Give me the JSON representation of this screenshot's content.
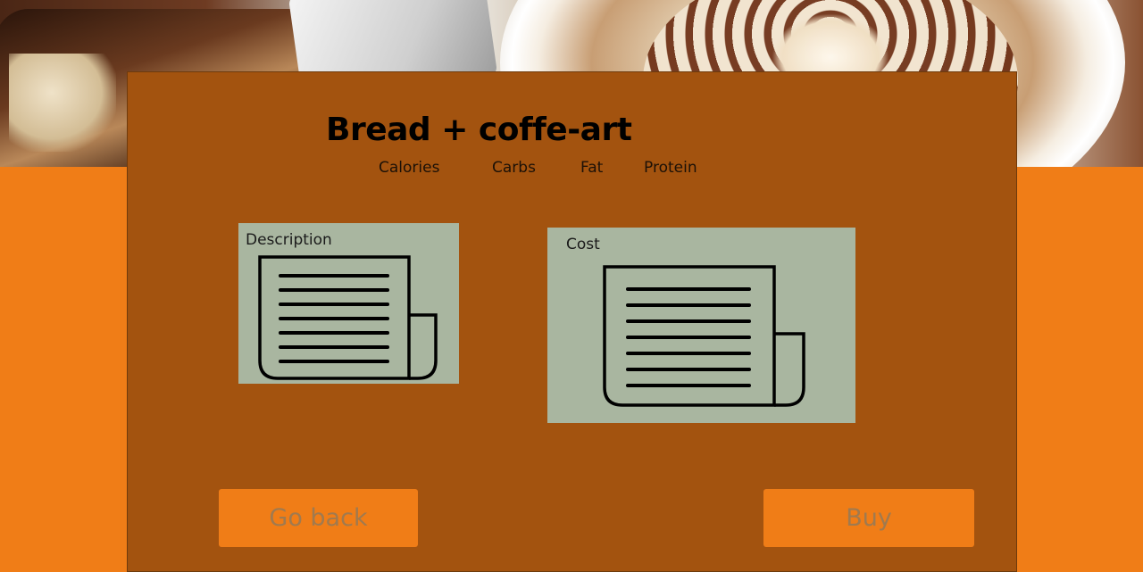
{
  "product": {
    "title": "Bread + coffe-art"
  },
  "nutrition": {
    "calories_label": "Calories",
    "carbs_label": "Carbs",
    "fat_label": "Fat",
    "protein_label": "Protein"
  },
  "description": {
    "label": "Description",
    "icon": "newspaper-icon"
  },
  "cost": {
    "label": "Cost",
    "icon": "newspaper-icon"
  },
  "actions": {
    "back_label": "Go back",
    "buy_label": "Buy"
  },
  "colors": {
    "page_background": "#f07d17",
    "panel": "#a3530f",
    "info_box": "#a9b6a0",
    "button": "#f07d17",
    "button_text": "#a07a4f"
  }
}
